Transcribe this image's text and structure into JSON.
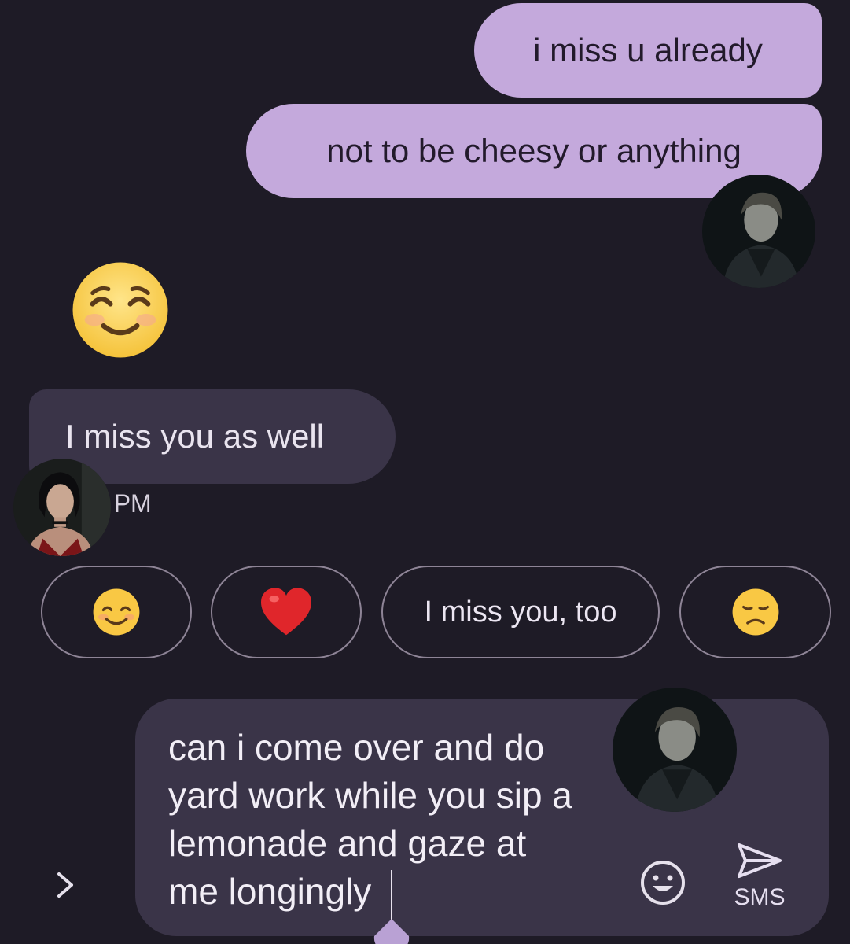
{
  "conversation": {
    "outgoing": [
      {
        "text": "i miss u already"
      },
      {
        "text": "not to be cheesy or anything"
      }
    ],
    "incoming_emoji": "smiling-face-with-smiling-eyes",
    "incoming": {
      "text": "I miss you as well"
    },
    "timestamp": "9 PM"
  },
  "smart_replies": [
    {
      "label": "",
      "icon": "smiling-face-emoji"
    },
    {
      "label": "",
      "icon": "red-heart-emoji"
    },
    {
      "label": "I miss you, too",
      "icon": ""
    },
    {
      "label": "",
      "icon": "sad-face-emoji"
    }
  ],
  "composer": {
    "text": "can i come over and do\nyard work while you sip a\nlemonade and gaze at\nme longingly",
    "send_label": "SMS"
  },
  "colors": {
    "background": "#1e1b26",
    "outgoing_bubble": "#c4a9dc",
    "incoming_bubble": "#3a3448",
    "chip_border": "#8e8496"
  }
}
